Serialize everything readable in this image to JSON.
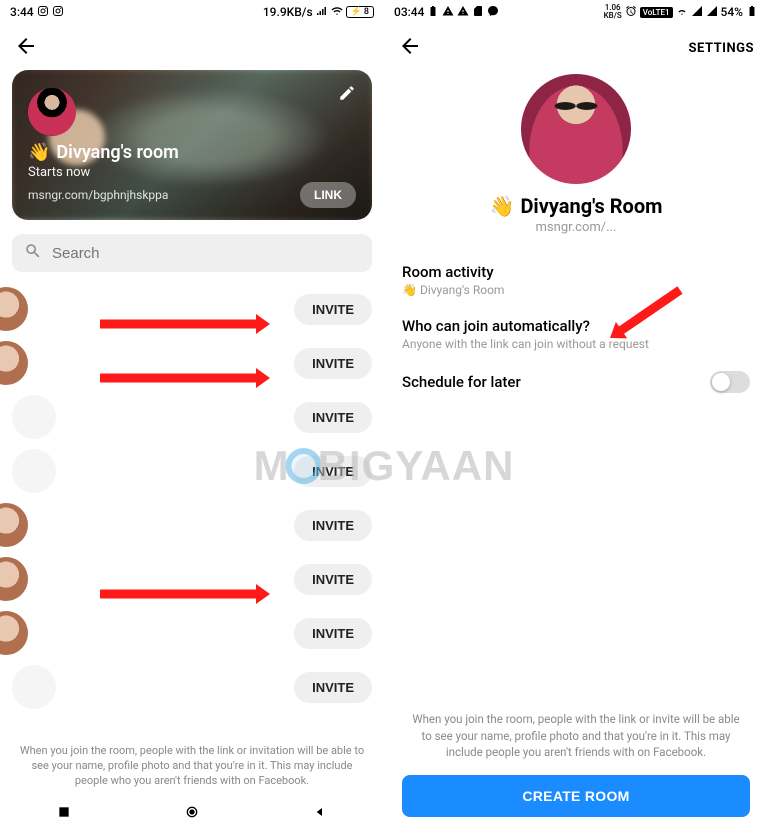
{
  "left": {
    "status": {
      "time": "3:44",
      "net_speed": "19.9KB/s",
      "battery_level": "8"
    },
    "room": {
      "title": "Divyang's room",
      "starts": "Starts now",
      "url": "msngr.com/bgphnjhskppa",
      "link_btn": "LINK"
    },
    "search": {
      "placeholder": "Search"
    },
    "invite_label": "INVITE",
    "contacts": [
      {
        "half": true,
        "blank": false,
        "arrow": true
      },
      {
        "half": true,
        "blank": false,
        "arrow": true
      },
      {
        "half": false,
        "blank": true,
        "arrow": false
      },
      {
        "half": false,
        "blank": true,
        "arrow": false
      },
      {
        "half": true,
        "blank": false,
        "arrow": false
      },
      {
        "half": true,
        "blank": false,
        "arrow": true
      },
      {
        "half": true,
        "blank": false,
        "arrow": false
      },
      {
        "half": false,
        "blank": true,
        "arrow": false
      }
    ],
    "disclaimer": "When you join the room, people with the link or invitation will be able to see your name, profile photo and that you're in it. This may include people who you aren't friends with on Facebook."
  },
  "right": {
    "status": {
      "time": "03:44",
      "net_speed": "1.06",
      "net_unit": "KB/S",
      "volte": "VoLTE1",
      "battery": "54%"
    },
    "settings_label": "SETTINGS",
    "profile": {
      "name": "Divyang's Room",
      "url": "msngr.com/..."
    },
    "settings": {
      "activity_title": "Room activity",
      "activity_sub": "Divyang's Room",
      "who_title": "Who can join automatically?",
      "who_sub": "Anyone with the link can join without a request",
      "schedule_title": "Schedule for later"
    },
    "disclaimer": "When you join the room, people with the link or invite will be able to see your name, profile photo and that you're in it. This may include people you aren't friends with on Facebook.",
    "create_btn": "CREATE ROOM"
  },
  "watermark": {
    "pre": "M",
    "post": "BIGYAAN"
  }
}
